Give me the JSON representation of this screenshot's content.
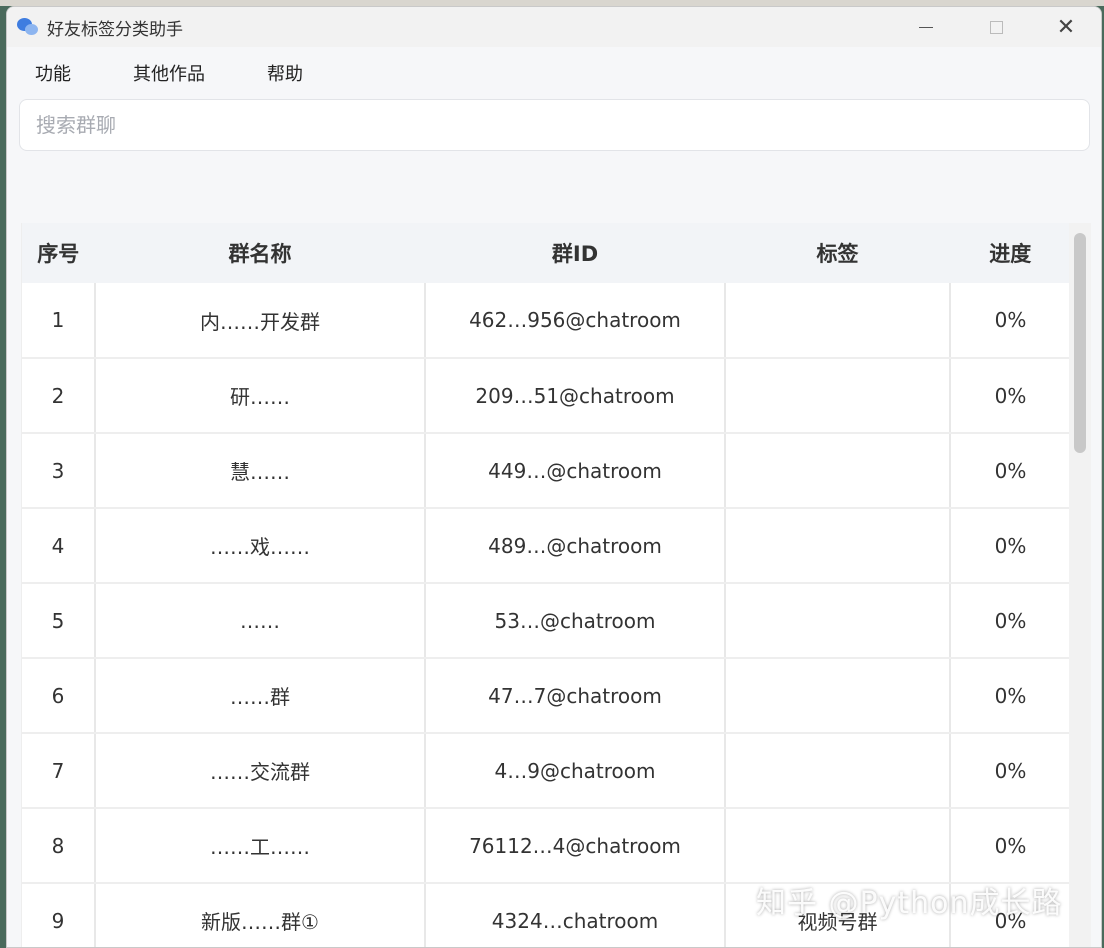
{
  "window": {
    "title": "好友标签分类助手"
  },
  "menu": [
    "功能",
    "其他作品",
    "帮助"
  ],
  "search": {
    "placeholder": "搜索群聊",
    "value": ""
  },
  "table": {
    "headers": [
      "序号",
      "群名称",
      "群ID",
      "标签",
      "进度"
    ],
    "rows": [
      {
        "idx": "1",
        "name": "内……开发群",
        "id": "462…956@chatroom",
        "tag": "",
        "progress": "0%"
      },
      {
        "idx": "2",
        "name": "研……",
        "id": "209…51@chatroom",
        "tag": "",
        "progress": "0%"
      },
      {
        "idx": "3",
        "name": "慧……",
        "id": "449…@chatroom",
        "tag": "",
        "progress": "0%"
      },
      {
        "idx": "4",
        "name": "……戏……",
        "id": "489…@chatroom",
        "tag": "",
        "progress": "0%"
      },
      {
        "idx": "5",
        "name": "……",
        "id": "53…@chatroom",
        "tag": "",
        "progress": "0%"
      },
      {
        "idx": "6",
        "name": "……群",
        "id": "47…7@chatroom",
        "tag": "",
        "progress": "0%"
      },
      {
        "idx": "7",
        "name": "……交流群",
        "id": "4…9@chatroom",
        "tag": "",
        "progress": "0%"
      },
      {
        "idx": "8",
        "name": "……工……",
        "id": "76112…4@chatroom",
        "tag": "",
        "progress": "0%"
      },
      {
        "idx": "9",
        "name": "新版……群①",
        "id": "4324…chatroom",
        "tag": "视频号群",
        "progress": "0%"
      }
    ]
  },
  "watermark": "知乎 @Python成长路",
  "icons": {
    "app": "chat-bubble-icon",
    "minimize": "minimize-icon",
    "maximize": "maximize-icon",
    "close": "close-icon"
  },
  "colors": {
    "accent": "#3f7de0",
    "header_bg": "#f2f4f7",
    "content_bg": "#f6f7f9"
  }
}
